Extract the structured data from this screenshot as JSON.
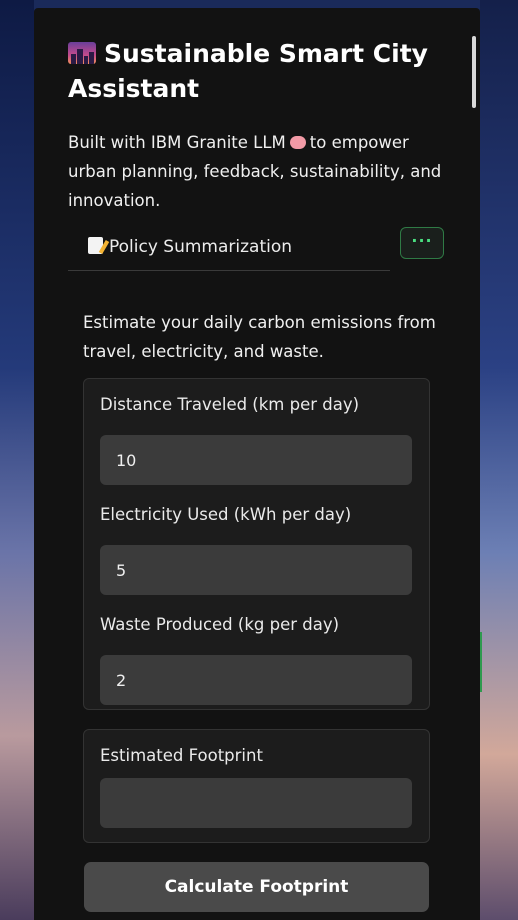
{
  "app": {
    "title": "Sustainable Smart City Assistant",
    "subtitle_before_icon": "Built with IBM Granite LLM",
    "subtitle_after_icon": "to empower urban planning, feedback, sustainability, and innovation.",
    "title_icon": "city-sunset-icon",
    "subtitle_icon": "brain-icon"
  },
  "tabs": {
    "active_label": "Policy Summarization",
    "active_icon": "memo-icon",
    "more_label": "···"
  },
  "calculator": {
    "description": "Estimate your daily carbon emissions from travel, electricity, and waste.",
    "fields": [
      {
        "label": "Distance Traveled (km per day)",
        "value": "10"
      },
      {
        "label": "Electricity Used (kWh per day)",
        "value": "5"
      },
      {
        "label": "Waste Produced (kg per day)",
        "value": "2"
      }
    ],
    "result_label": "Estimated Footprint",
    "result_value": "",
    "button_label": "Calculate Footprint"
  },
  "colors": {
    "panel_bg": "#121212",
    "card_bg": "#1c1c1c",
    "input_bg": "#3b3b3b",
    "button_bg": "#4a4a4a",
    "accent_green": "#4ade80"
  }
}
